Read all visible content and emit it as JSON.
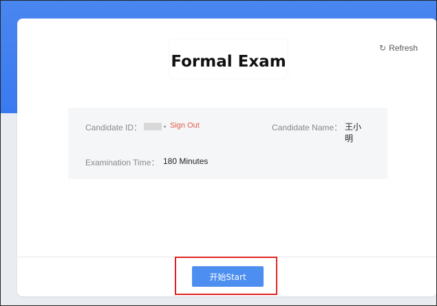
{
  "exam": {
    "title": "Formal Exam",
    "refresh_label": "Refresh"
  },
  "candidate": {
    "id_label": "Candidate ID：",
    "sign_out_label": "Sign Out",
    "name_label": "Candidate Name：",
    "name_value": "王小明",
    "time_label": "Examination Time：",
    "time_value": "180 Minutes"
  },
  "actions": {
    "start_label": "开始Start"
  },
  "icons": {
    "refresh": "refresh-icon"
  },
  "colors": {
    "header_blue": "#3a7af0",
    "button_blue": "#4d8ff0",
    "sign_out_red": "#e05a4a",
    "highlight_red": "#e02020"
  }
}
